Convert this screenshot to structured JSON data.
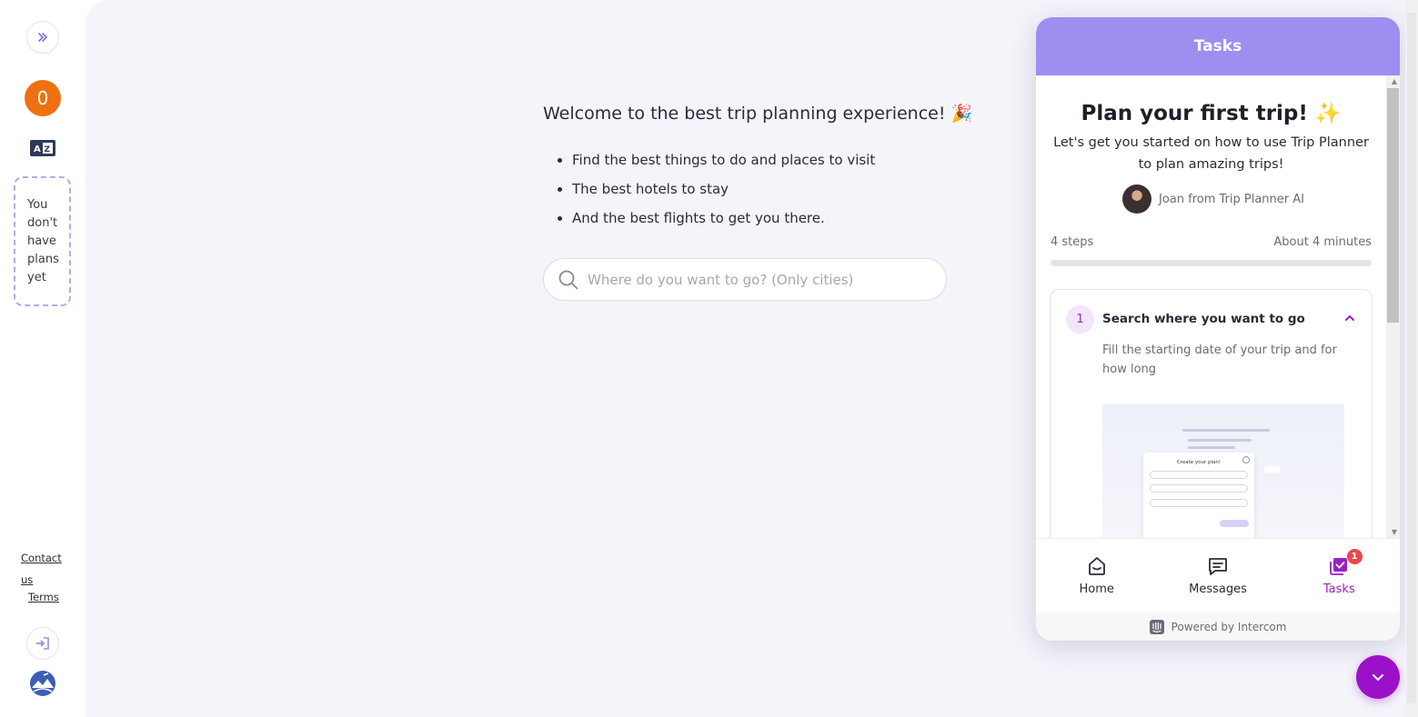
{
  "sidebar": {
    "credits": "0",
    "plans_empty_lines": [
      "You",
      "don't",
      "have",
      "plans",
      "yet"
    ],
    "contact_label": "Contact us",
    "terms_label": "Terms"
  },
  "main": {
    "welcome": "Welcome to the best trip planning experience! 🎉",
    "features": [
      "Find the best things to do and places to visit",
      "The best hotels to stay",
      "And the best flights to get you there."
    ],
    "search_placeholder": "Where do you want to go? (Only cities)"
  },
  "widget": {
    "header_title": "Tasks",
    "plan_title": "Plan your first trip! ✨",
    "plan_subtitle": "Let's get you started on how to use Trip Planner to plan amazing trips!",
    "author": "Joan from Trip Planner AI",
    "steps_count": "4 steps",
    "duration": "About 4 minutes",
    "progress_fraction": 0,
    "step": {
      "number": "1",
      "title": "Search where you want to go",
      "description": "Fill the starting date of your trip and for how long",
      "preview_modal_title": "Create your plan!"
    },
    "nav": {
      "home": "Home",
      "messages": "Messages",
      "tasks": "Tasks",
      "tasks_badge": "1"
    },
    "powered_by": "Powered by Intercom"
  },
  "colors": {
    "accent_purple": "#9d8ef0",
    "launcher_purple": "#9b11c9",
    "credits_orange": "#ef7011"
  }
}
